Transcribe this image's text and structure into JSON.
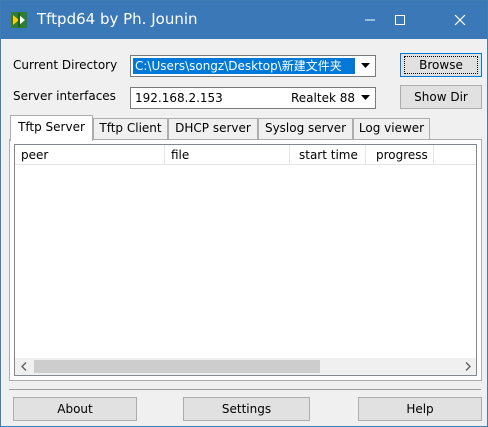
{
  "window": {
    "title": "Tftpd64 by Ph. Jounin",
    "minimize_icon": "minimize-icon",
    "maximize_icon": "maximize-icon",
    "close_icon": "close-icon",
    "titlebar_color": "#3a78b8"
  },
  "fields": {
    "current_directory_label": "Current Directory",
    "current_directory_value": "C:\\Users\\songz\\Desktop\\新建文件夹",
    "server_interfaces_label": "Server interfaces",
    "server_interfaces_ip": "192.168.2.153",
    "server_interfaces_adapter": "Realtek 88"
  },
  "buttons": {
    "browse": "Browse",
    "show_dir": "Show Dir",
    "about": "About",
    "settings": "Settings",
    "help": "Help"
  },
  "tabs": [
    {
      "label": "Tftp Server",
      "active": true
    },
    {
      "label": "Tftp Client",
      "active": false
    },
    {
      "label": "DHCP server",
      "active": false
    },
    {
      "label": "Syslog server",
      "active": false
    },
    {
      "label": "Log viewer",
      "active": false
    }
  ],
  "table": {
    "columns": [
      "peer",
      "file",
      "start time",
      "progress"
    ],
    "rows": []
  },
  "colors": {
    "selection": "#0078d7",
    "focus_border": "#0078d7"
  }
}
